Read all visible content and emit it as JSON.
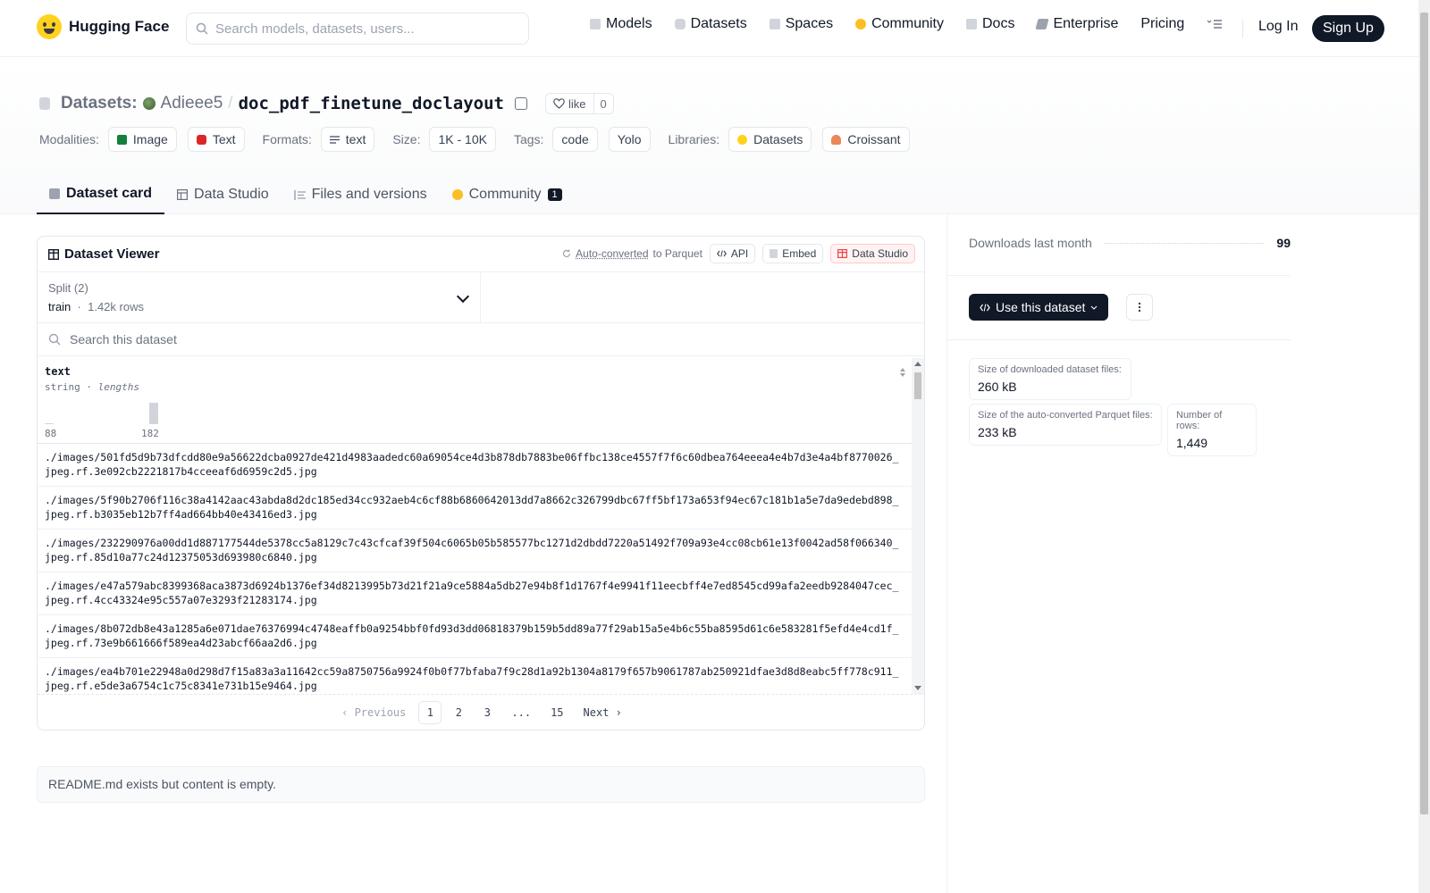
{
  "header": {
    "brand": "Hugging Face",
    "search_placeholder": "Search models, datasets, users...",
    "nav": [
      {
        "label": "Models",
        "icon": "models-icon",
        "color": "#9ca3af"
      },
      {
        "label": "Datasets",
        "icon": "datasets-icon",
        "color": "#9ca3af"
      },
      {
        "label": "Spaces",
        "icon": "spaces-icon",
        "color": "#9ca3af"
      },
      {
        "label": "Community",
        "icon": "community-icon",
        "color": "#fbbf24"
      },
      {
        "label": "Docs",
        "icon": "docs-icon",
        "color": "#9ca3af"
      },
      {
        "label": "Enterprise",
        "icon": "enterprise-icon",
        "color": "#9ca3af"
      },
      {
        "label": "Pricing"
      }
    ],
    "login": "Log In",
    "signup": "Sign Up"
  },
  "repo": {
    "section": "Datasets:",
    "owner": "Adieee5",
    "separator": "/",
    "name": "doc_pdf_finetune_doclayout",
    "like_label": "like",
    "like_count": "0"
  },
  "meta": {
    "modalities_label": "Modalities:",
    "modalities": [
      "Image",
      "Text"
    ],
    "formats_label": "Formats:",
    "formats": [
      "text"
    ],
    "size_label": "Size:",
    "size": "1K - 10K",
    "tags_label": "Tags:",
    "tags": [
      "code",
      "Yolo"
    ],
    "libraries_label": "Libraries:",
    "libraries": [
      "Datasets",
      "Croissant"
    ]
  },
  "tabs": [
    {
      "label": "Dataset card",
      "active": true
    },
    {
      "label": "Data Studio"
    },
    {
      "label": "Files and versions"
    },
    {
      "label": "Community",
      "badge": "1"
    }
  ],
  "viewer": {
    "title": "Dataset Viewer",
    "auto_converted": "Auto-converted",
    "to_parquet": "to Parquet",
    "api": "API",
    "embed": "Embed",
    "data_studio": "Data Studio",
    "split_label": "Split (2)",
    "split_value": "train",
    "split_dot": "·",
    "split_rows": "1.42k rows",
    "search_placeholder": "Search this dataset",
    "column": {
      "name": "text",
      "type": "string",
      "dot": "·",
      "stat": "lengths",
      "min": "88",
      "max": "182"
    },
    "rows": [
      "./images/501fd5d9b73dfcdd80e9a56622dcba0927de421d4983aadedc60a69054ce4d3b878db7883be06ffbc138ce4557f7f6c60dbea764eeea4e4b7d3e4a4bf8770026_jpeg.rf.3e092cb2221817b4cceeaf6d6959c2d5.jpg",
      "./images/5f90b2706f116c38a4142aac43abda8d2dc185ed34cc932aeb4c6cf88b6860642013dd7a8662c326799dbc67ff5bf173a653f94ec67c181b1a5e7da9edebd898_jpeg.rf.b3035eb12b7ff4ad664bb40e43416ed3.jpg",
      "./images/232290976a00dd1d887177544de5378cc5a8129c7c43cfcaf39f504c6065b05b585577bc1271d2dbdd7220a51492f709a93e4cc08cb61e13f0042ad58f066340_jpeg.rf.85d10a77c24d12375053d693980c6840.jpg",
      "./images/e47a579abc8399368aca3873d6924b1376ef34d8213995b73d21f21a9ce5884a5db27e94b8f1d1767f4e9941f11eecbff4e7ed8545cd99afa2eedb9284047cec_jpeg.rf.4cc43324e95c557a07e3293f21283174.jpg",
      "./images/8b072db8e43a1285a6e071dae76376994c4748eaffb0a9254bbf0fd93d3dd06818379b159b5dd89a77f29ab15a5e4b6c55ba8595d61c6e583281f5efd4e4cd1f_jpeg.rf.73e9b661666f589ea4d23abcf66aa2d6.jpg",
      "./images/ea4b701e22948a0d298d7f15a83a3a11642cc59a8750756a9924f0b0f77bfaba7f9c28d1a92b1304a8179f657b9061787ab250921dfae3d8d8eabc5ff778c911_jpeg.rf.e5de3a6754c1c75c8341e731b15e9464.jpg"
    ],
    "pager": {
      "prev": "Previous",
      "pages": [
        "1",
        "2",
        "3",
        "...",
        "15"
      ],
      "next": "Next",
      "current": "1"
    }
  },
  "readme_text": "README.md exists but content is empty.",
  "sidebar": {
    "downloads_label": "Downloads last month",
    "downloads_value": "99",
    "use_dataset": "Use this dataset",
    "stats": [
      {
        "label": "Size of downloaded dataset files:",
        "value": "260 kB"
      },
      {
        "label": "Size of the auto-converted Parquet files:",
        "value": "233 kB"
      },
      {
        "label": "Number of rows:",
        "value": "1,449"
      }
    ]
  },
  "colors": {
    "dark": "#111827",
    "muted": "#6b7280",
    "border": "#e5e7eb",
    "image_chip": "#15803d",
    "text_chip": "#dc2626",
    "data_studio_accent": "#ef4444"
  }
}
